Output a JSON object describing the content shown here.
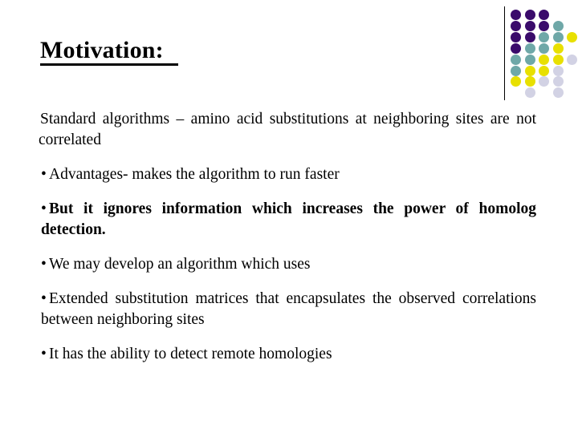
{
  "slide": {
    "title": "Motivation:",
    "background_color": "#ffffff",
    "text_color": "#000000"
  },
  "decoration": {
    "name": "dot-matrix",
    "rows": 8,
    "columns": 5,
    "palette": {
      "dark_purple": "#3A0B6B",
      "teal": "#6FA8A8",
      "yellow": "#E8E000",
      "lavender": "#D2D2E4"
    },
    "rule_color": "#000000",
    "cells": [
      [
        "dark_purple",
        "dark_purple",
        "dark_purple",
        null,
        null
      ],
      [
        "dark_purple",
        "dark_purple",
        "dark_purple",
        "teal",
        null
      ],
      [
        "dark_purple",
        "dark_purple",
        "teal",
        "teal",
        "yellow"
      ],
      [
        "dark_purple",
        "teal",
        "teal",
        "yellow",
        null
      ],
      [
        "teal",
        "teal",
        "yellow",
        "yellow",
        "lavender"
      ],
      [
        "teal",
        "yellow",
        "yellow",
        "lavender",
        null
      ],
      [
        "yellow",
        "yellow",
        "lavender",
        "lavender",
        null
      ],
      [
        null,
        "lavender",
        null,
        "lavender",
        null
      ]
    ]
  },
  "content": {
    "blocks": [
      {
        "id": "lead-paragraph",
        "bullet": "",
        "text": "Standard algorithms – amino acid substitutions at neighboring sites are not correlated"
      },
      {
        "id": "bullet-advantages",
        "bullet": "•",
        "text": "Advantages- makes the algorithm to run faster"
      },
      {
        "id": "bullet-ignores-information",
        "bullet": "•",
        "text": "But it ignores information which increases the power of homolog detection."
      },
      {
        "id": "bullet-may-develop",
        "bullet": "•",
        "text": "We may develop an algorithm which  uses"
      },
      {
        "id": "bullet-extended-matrices",
        "bullet": "•",
        "text": "Extended substitution matrices that encapsulates the observed correlations between neighboring sites"
      },
      {
        "id": "bullet-remote-homologies",
        "bullet": "•",
        "text": "It has the ability to detect remote homologies"
      }
    ]
  }
}
